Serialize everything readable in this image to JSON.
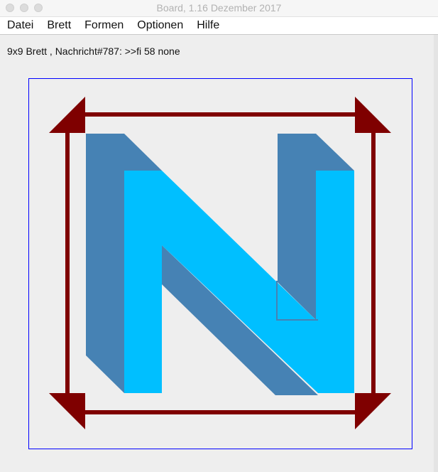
{
  "window": {
    "title": "Board, 1.16 Dezember 2017"
  },
  "menu": {
    "items": [
      "Datei",
      "Brett",
      "Formen",
      "Optionen",
      "Hilfe"
    ]
  },
  "status": {
    "text": "9x9 Brett , Nachricht#787: >>fi 58 none"
  },
  "board": {
    "frame_color": "#0000ff",
    "arrow_color": "#7f0000",
    "letter_front_color": "#00bfff",
    "letter_shadow_color": "#4682b4"
  }
}
